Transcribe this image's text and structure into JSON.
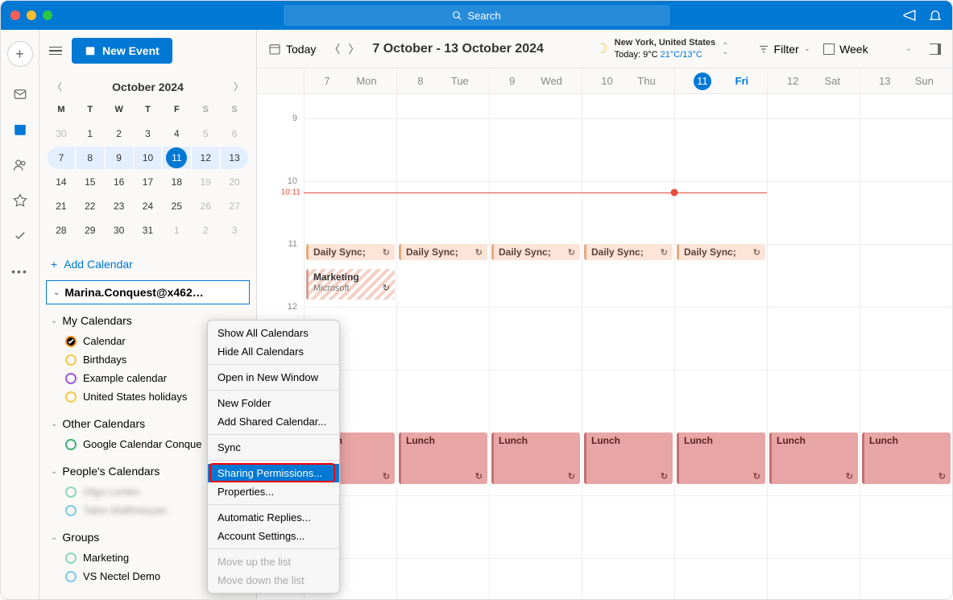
{
  "search_placeholder": "Search",
  "new_event_label": "New Event",
  "toolbar": {
    "today": "Today",
    "date_range": "7 October - 13 October 2024",
    "weather": {
      "location": "New York, United States",
      "today_label": "Today:",
      "current": "9°C",
      "hilo": "21°C/13°C"
    },
    "filter": "Filter",
    "view": "Week"
  },
  "mini_cal": {
    "title": "October 2024",
    "dow": [
      "M",
      "T",
      "W",
      "T",
      "F",
      "S",
      "S"
    ],
    "days": [
      {
        "n": "30",
        "other": true
      },
      {
        "n": "1"
      },
      {
        "n": "2"
      },
      {
        "n": "3"
      },
      {
        "n": "4"
      },
      {
        "n": "5",
        "other": true
      },
      {
        "n": "6",
        "other": true
      },
      {
        "n": "7",
        "wk": true,
        "first": true
      },
      {
        "n": "8",
        "wk": true
      },
      {
        "n": "9",
        "wk": true
      },
      {
        "n": "10",
        "wk": true
      },
      {
        "n": "11",
        "wk": true,
        "today": true
      },
      {
        "n": "12",
        "wk": true
      },
      {
        "n": "13",
        "wk": true,
        "last": true
      },
      {
        "n": "14"
      },
      {
        "n": "15"
      },
      {
        "n": "16"
      },
      {
        "n": "17"
      },
      {
        "n": "18"
      },
      {
        "n": "19",
        "other": true
      },
      {
        "n": "20",
        "other": true
      },
      {
        "n": "21"
      },
      {
        "n": "22"
      },
      {
        "n": "23"
      },
      {
        "n": "24"
      },
      {
        "n": "25"
      },
      {
        "n": "26",
        "other": true
      },
      {
        "n": "27",
        "other": true
      },
      {
        "n": "28"
      },
      {
        "n": "29"
      },
      {
        "n": "30"
      },
      {
        "n": "31"
      },
      {
        "n": "1",
        "other": true
      },
      {
        "n": "2",
        "other": true
      },
      {
        "n": "3",
        "other": true
      }
    ]
  },
  "add_calendar": "Add Calendar",
  "account_email": "Marina.Conquest@x462…",
  "groups": {
    "my": {
      "label": "My Calendars",
      "items": [
        {
          "label": "Calendar",
          "color": "#f7941d",
          "filled": true,
          "check": true
        },
        {
          "label": "Birthdays",
          "color": "#f7c948"
        },
        {
          "label": "Example calendar",
          "color": "#a259d9"
        },
        {
          "label": "United States holidays",
          "color": "#f7c948"
        }
      ]
    },
    "other": {
      "label": "Other Calendars",
      "items": [
        {
          "label": "Google Calendar Conque",
          "color": "#3cb371"
        }
      ]
    },
    "people": {
      "label": "People's Calendars",
      "items": [
        {
          "label": "Olga Lomko",
          "color": "#8fd9b6",
          "blur": true
        },
        {
          "label": "Talon Malkhasyan",
          "color": "#7fc8e8",
          "blur": true
        }
      ]
    },
    "grp": {
      "label": "Groups",
      "items": [
        {
          "label": "Marketing",
          "color": "#8fd9b6"
        },
        {
          "label": "VS Nectel Demo",
          "color": "#7fc8e8"
        }
      ]
    }
  },
  "week_days": [
    {
      "num": "7",
      "name": "Mon"
    },
    {
      "num": "8",
      "name": "Tue"
    },
    {
      "num": "9",
      "name": "Wed"
    },
    {
      "num": "10",
      "name": "Thu"
    },
    {
      "num": "11",
      "name": "Fri",
      "today": true
    },
    {
      "num": "12",
      "name": "Sat"
    },
    {
      "num": "13",
      "name": "Sun"
    }
  ],
  "now_time": "10:11",
  "events": {
    "daily_sync": "Daily Sync;",
    "marketing_title": "Marketing",
    "marketing_sub": "Microsoft",
    "lunch": "Lunch"
  },
  "context_menu": [
    {
      "label": "Show All Calendars"
    },
    {
      "label": "Hide All Calendars"
    },
    {
      "sep": true
    },
    {
      "label": "Open in New Window"
    },
    {
      "sep": true
    },
    {
      "label": "New Folder"
    },
    {
      "label": "Add Shared Calendar..."
    },
    {
      "sep": true
    },
    {
      "label": "Sync"
    },
    {
      "sep": true
    },
    {
      "label": "Sharing Permissions...",
      "hl": true
    },
    {
      "label": "Properties..."
    },
    {
      "sep": true
    },
    {
      "label": "Automatic Replies..."
    },
    {
      "label": "Account Settings..."
    },
    {
      "sep": true
    },
    {
      "label": "Move up the list",
      "disabled": true
    },
    {
      "label": "Move down the list",
      "disabled": true
    }
  ]
}
